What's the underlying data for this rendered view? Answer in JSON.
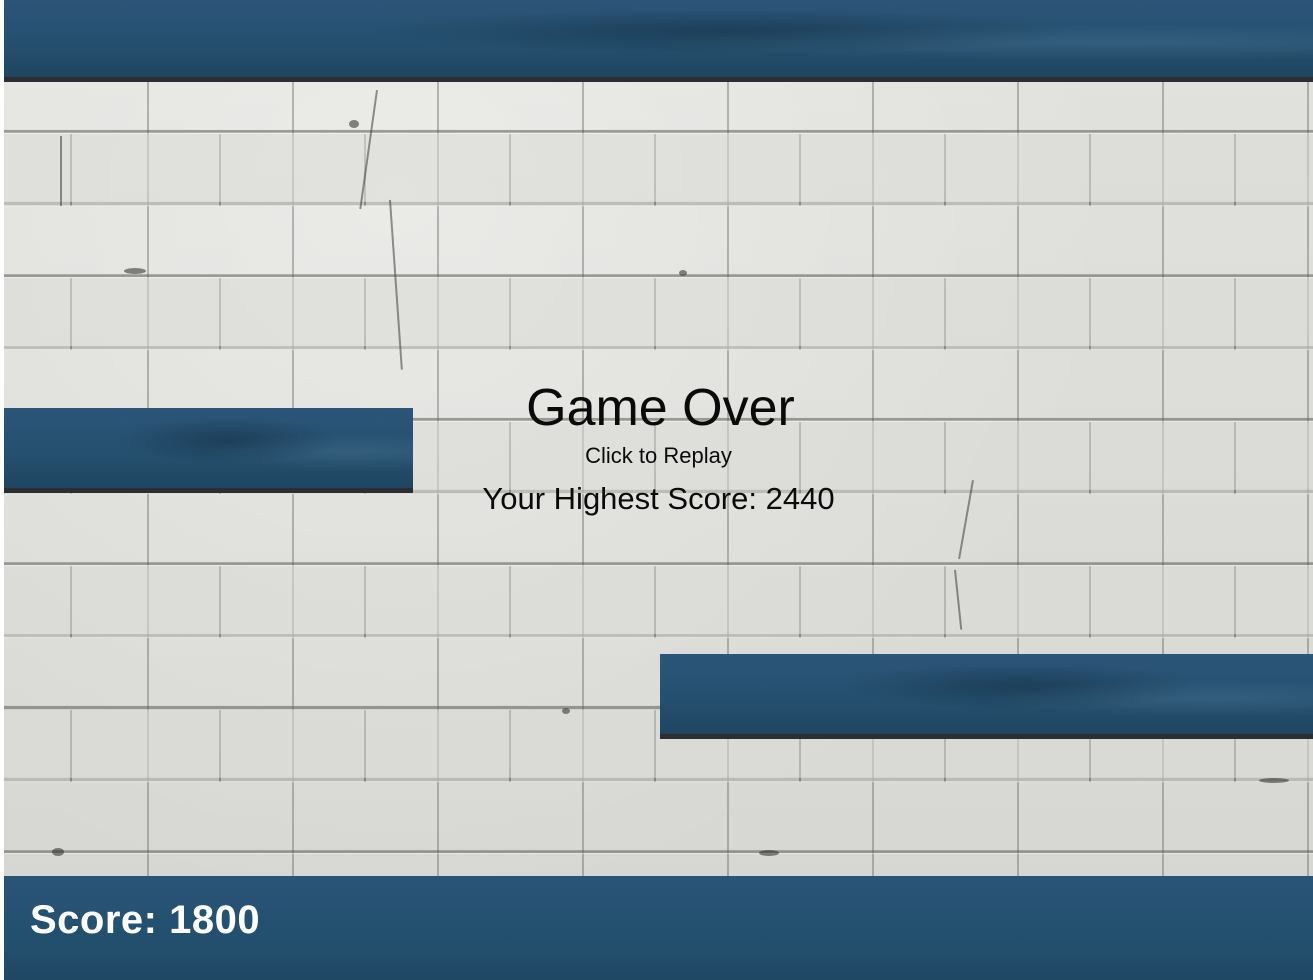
{
  "game": {
    "state": "game-over"
  },
  "overlay": {
    "title": "Game Over",
    "replay_hint": "Click to Replay",
    "highest_score_label": "Your Highest Score:",
    "highest_score_value": 2440,
    "highest_score_text": "Your Highest Score: 2440"
  },
  "hud": {
    "score_label": "Score:",
    "score_value": 1800,
    "score_text": "Score: 1800"
  },
  "colors": {
    "beam": "#25506f",
    "beam_shadow": "#2b2f33",
    "wall": "#dcdcd8",
    "overlay_text": "#0a0a0a",
    "hud_text": "#ffffff"
  }
}
